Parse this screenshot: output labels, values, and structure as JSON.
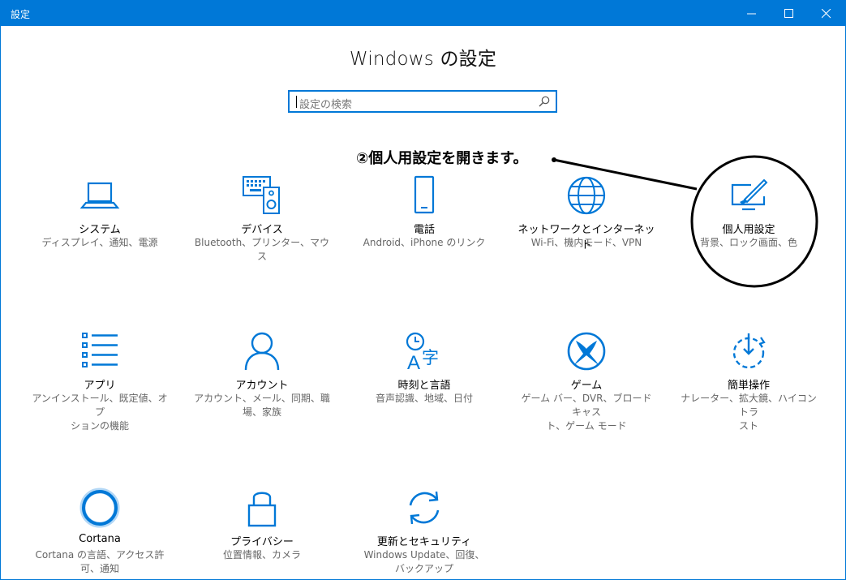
{
  "window": {
    "title": "設定",
    "accent_color": "#0078d7"
  },
  "page_title": "Windows の設定",
  "search": {
    "placeholder": "設定の検索"
  },
  "annotation": {
    "text": "②個人用設定を開きます。"
  },
  "tiles": [
    {
      "label": "システム",
      "desc_lines": [
        "ディスプレイ、通知、電源"
      ],
      "icon": "laptop-icon"
    },
    {
      "label": "デバイス",
      "desc_lines": [
        "Bluetooth、プリンター、マウス"
      ],
      "icon": "keyboard-speaker-icon"
    },
    {
      "label": "電話",
      "desc_lines": [
        "Android、iPhone のリンク"
      ],
      "icon": "phone-icon"
    },
    {
      "label": "ネットワークとインターネット",
      "desc_lines": [
        "Wi-Fi、機内モード、VPN"
      ],
      "icon": "globe-icon"
    },
    {
      "label": "個人用設定",
      "desc_lines": [
        "背景、ロック画面、色"
      ],
      "icon": "paint-monitor-icon"
    },
    {
      "label": "アプリ",
      "desc_lines": [
        "アンインストール、既定値、オプ",
        "ションの機能"
      ],
      "icon": "apps-list-icon"
    },
    {
      "label": "アカウント",
      "desc_lines": [
        "アカウント、メール、同期、職",
        "場、家族"
      ],
      "icon": "person-icon"
    },
    {
      "label": "時刻と言語",
      "desc_lines": [
        "音声認識、地域、日付"
      ],
      "icon": "time-language-icon"
    },
    {
      "label": "ゲーム",
      "desc_lines": [
        "ゲーム バー、DVR、ブロードキャス",
        "ト、ゲーム モード"
      ],
      "icon": "xbox-icon"
    },
    {
      "label": "簡単操作",
      "desc_lines": [
        "ナレーター、拡大鏡、ハイコントラ",
        "スト"
      ],
      "icon": "ease-of-access-icon"
    },
    {
      "label": "Cortana",
      "desc_lines": [
        "Cortana の言語、アクセス許",
        "可、通知"
      ],
      "icon": "cortana-icon"
    },
    {
      "label": "プライバシー",
      "desc_lines": [
        "位置情報、カメラ"
      ],
      "icon": "lock-icon"
    },
    {
      "label": "更新とセキュリティ",
      "desc_lines": [
        "Windows Update、回復、",
        "バックアップ"
      ],
      "icon": "sync-icon"
    }
  ]
}
